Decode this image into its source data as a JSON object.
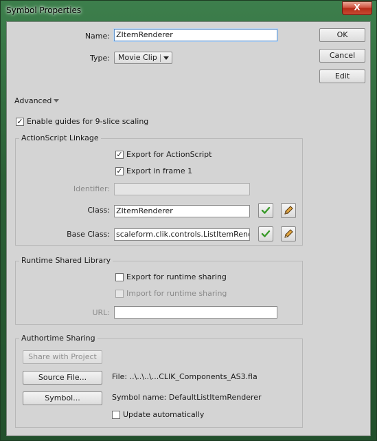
{
  "window": {
    "title": "Symbol Properties",
    "close_glyph": "X"
  },
  "form": {
    "name_label": "Name:",
    "name_value": "ZItemRenderer",
    "type_label": "Type:",
    "type_value": "Movie Clip"
  },
  "buttons": {
    "ok": "OK",
    "cancel": "Cancel",
    "edit": "Edit"
  },
  "advanced": {
    "label": "Advanced",
    "enable_guides_label": "Enable guides for 9-slice scaling",
    "enable_guides_checked": true
  },
  "actionscript_linkage": {
    "title": "ActionScript Linkage",
    "export_actionscript_label": "Export for ActionScript",
    "export_actionscript_checked": true,
    "export_frame1_label": "Export in frame 1",
    "export_frame1_checked": true,
    "identifier_label": "Identifier:",
    "identifier_value": "",
    "class_label": "Class:",
    "class_value": "ZItemRenderer",
    "base_class_label": "Base Class:",
    "base_class_value": "scaleform.clik.controls.ListItemRenderer"
  },
  "runtime_shared_library": {
    "title": "Runtime Shared Library",
    "export_runtime_label": "Export for runtime sharing",
    "export_runtime_checked": false,
    "import_runtime_label": "Import for runtime sharing",
    "import_runtime_checked": false,
    "url_label": "URL:",
    "url_value": ""
  },
  "authortime_sharing": {
    "title": "Authortime Sharing",
    "share_button": "Share with Project",
    "source_file_button": "Source File...",
    "file_text": "File: ..\\..\\..\\...CLIK_Components_AS3.fla",
    "symbol_button": "Symbol...",
    "symbol_name_text": "Symbol name: DefaultListItemRenderer",
    "update_auto_label": "Update automatically",
    "update_auto_checked": false
  },
  "colors": {
    "check_green": "#3a9a2a",
    "pencil_orange": "#c98a2a",
    "focus_blue": "#5d8fc7"
  }
}
